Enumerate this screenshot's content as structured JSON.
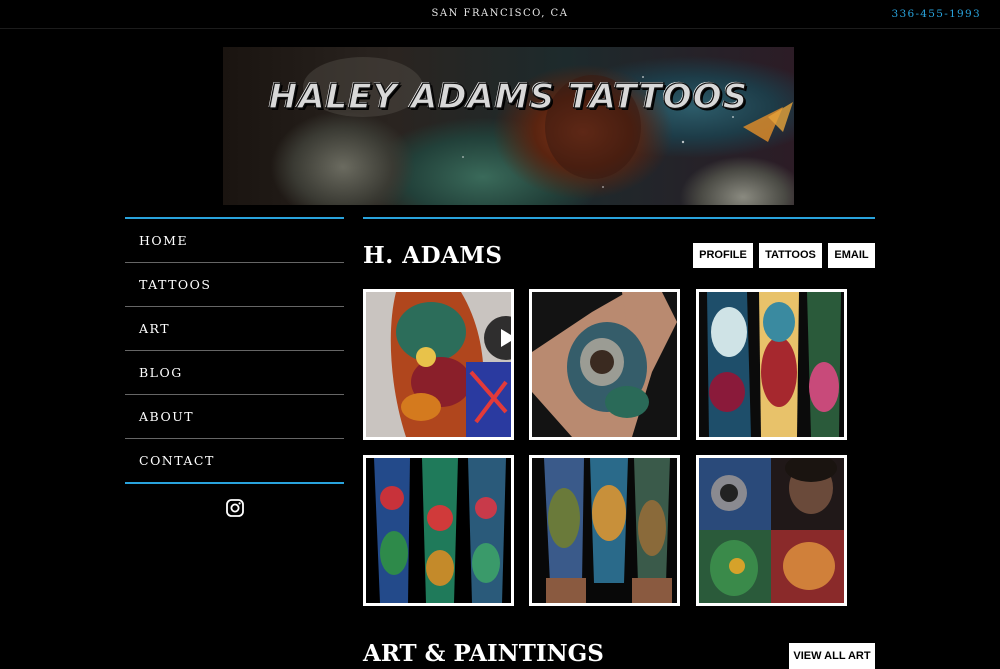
{
  "topbar": {
    "location": "SAN FRANCISCO, CA",
    "phone": "336-455-1993"
  },
  "banner": {
    "title": "HALEY ADAMS TATTOOS"
  },
  "nav": {
    "items": [
      {
        "label": "HOME"
      },
      {
        "label": "TATTOOS"
      },
      {
        "label": "ART"
      },
      {
        "label": "BLOG"
      },
      {
        "label": "ABOUT"
      },
      {
        "label": "CONTACT"
      }
    ],
    "social_icon": "instagram-icon"
  },
  "artist": {
    "name": "H. ADAMS",
    "buttons": [
      {
        "label": "PROFILE"
      },
      {
        "label": "TATTOOS"
      },
      {
        "label": "EMAIL"
      }
    ]
  },
  "gallery": {
    "thumbs": [
      {
        "subject": "cosmic sleeve tattoo video",
        "has_play_icon": true
      },
      {
        "subject": "astronaut hand tattoo"
      },
      {
        "subject": "space sleeve tattoos"
      },
      {
        "subject": "three galaxy sleeves"
      },
      {
        "subject": "forearm nature tattoos"
      },
      {
        "subject": "astronaut and portrait collage"
      }
    ]
  },
  "art_section": {
    "title": "ART & PAINTINGS",
    "view_all_label": "VIEW ALL ART"
  },
  "colors": {
    "accent": "#29a3dc",
    "background": "#000000",
    "button_bg": "#ffffff"
  }
}
